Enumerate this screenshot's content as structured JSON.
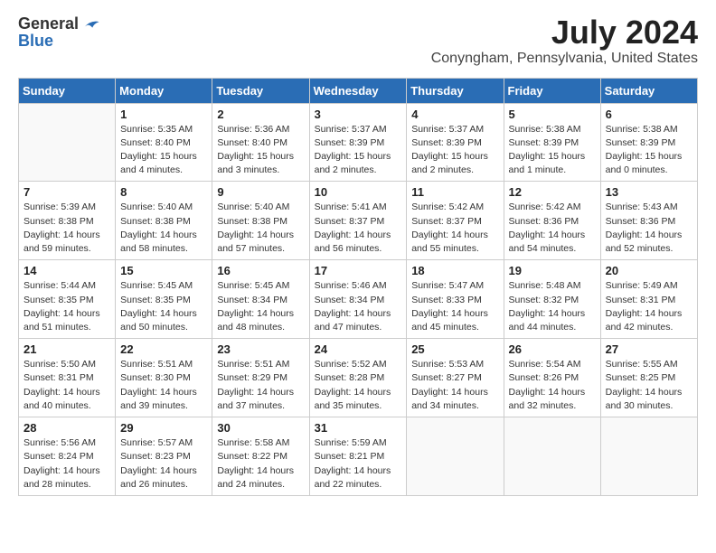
{
  "header": {
    "logo_general": "General",
    "logo_blue": "Blue",
    "month_year": "July 2024",
    "location": "Conyngham, Pennsylvania, United States"
  },
  "weekdays": [
    "Sunday",
    "Monday",
    "Tuesday",
    "Wednesday",
    "Thursday",
    "Friday",
    "Saturday"
  ],
  "weeks": [
    [
      {
        "day": "",
        "info": ""
      },
      {
        "day": "1",
        "info": "Sunrise: 5:35 AM\nSunset: 8:40 PM\nDaylight: 15 hours\nand 4 minutes."
      },
      {
        "day": "2",
        "info": "Sunrise: 5:36 AM\nSunset: 8:40 PM\nDaylight: 15 hours\nand 3 minutes."
      },
      {
        "day": "3",
        "info": "Sunrise: 5:37 AM\nSunset: 8:39 PM\nDaylight: 15 hours\nand 2 minutes."
      },
      {
        "day": "4",
        "info": "Sunrise: 5:37 AM\nSunset: 8:39 PM\nDaylight: 15 hours\nand 2 minutes."
      },
      {
        "day": "5",
        "info": "Sunrise: 5:38 AM\nSunset: 8:39 PM\nDaylight: 15 hours\nand 1 minute."
      },
      {
        "day": "6",
        "info": "Sunrise: 5:38 AM\nSunset: 8:39 PM\nDaylight: 15 hours\nand 0 minutes."
      }
    ],
    [
      {
        "day": "7",
        "info": "Sunrise: 5:39 AM\nSunset: 8:38 PM\nDaylight: 14 hours\nand 59 minutes."
      },
      {
        "day": "8",
        "info": "Sunrise: 5:40 AM\nSunset: 8:38 PM\nDaylight: 14 hours\nand 58 minutes."
      },
      {
        "day": "9",
        "info": "Sunrise: 5:40 AM\nSunset: 8:38 PM\nDaylight: 14 hours\nand 57 minutes."
      },
      {
        "day": "10",
        "info": "Sunrise: 5:41 AM\nSunset: 8:37 PM\nDaylight: 14 hours\nand 56 minutes."
      },
      {
        "day": "11",
        "info": "Sunrise: 5:42 AM\nSunset: 8:37 PM\nDaylight: 14 hours\nand 55 minutes."
      },
      {
        "day": "12",
        "info": "Sunrise: 5:42 AM\nSunset: 8:36 PM\nDaylight: 14 hours\nand 54 minutes."
      },
      {
        "day": "13",
        "info": "Sunrise: 5:43 AM\nSunset: 8:36 PM\nDaylight: 14 hours\nand 52 minutes."
      }
    ],
    [
      {
        "day": "14",
        "info": "Sunrise: 5:44 AM\nSunset: 8:35 PM\nDaylight: 14 hours\nand 51 minutes."
      },
      {
        "day": "15",
        "info": "Sunrise: 5:45 AM\nSunset: 8:35 PM\nDaylight: 14 hours\nand 50 minutes."
      },
      {
        "day": "16",
        "info": "Sunrise: 5:45 AM\nSunset: 8:34 PM\nDaylight: 14 hours\nand 48 minutes."
      },
      {
        "day": "17",
        "info": "Sunrise: 5:46 AM\nSunset: 8:34 PM\nDaylight: 14 hours\nand 47 minutes."
      },
      {
        "day": "18",
        "info": "Sunrise: 5:47 AM\nSunset: 8:33 PM\nDaylight: 14 hours\nand 45 minutes."
      },
      {
        "day": "19",
        "info": "Sunrise: 5:48 AM\nSunset: 8:32 PM\nDaylight: 14 hours\nand 44 minutes."
      },
      {
        "day": "20",
        "info": "Sunrise: 5:49 AM\nSunset: 8:31 PM\nDaylight: 14 hours\nand 42 minutes."
      }
    ],
    [
      {
        "day": "21",
        "info": "Sunrise: 5:50 AM\nSunset: 8:31 PM\nDaylight: 14 hours\nand 40 minutes."
      },
      {
        "day": "22",
        "info": "Sunrise: 5:51 AM\nSunset: 8:30 PM\nDaylight: 14 hours\nand 39 minutes."
      },
      {
        "day": "23",
        "info": "Sunrise: 5:51 AM\nSunset: 8:29 PM\nDaylight: 14 hours\nand 37 minutes."
      },
      {
        "day": "24",
        "info": "Sunrise: 5:52 AM\nSunset: 8:28 PM\nDaylight: 14 hours\nand 35 minutes."
      },
      {
        "day": "25",
        "info": "Sunrise: 5:53 AM\nSunset: 8:27 PM\nDaylight: 14 hours\nand 34 minutes."
      },
      {
        "day": "26",
        "info": "Sunrise: 5:54 AM\nSunset: 8:26 PM\nDaylight: 14 hours\nand 32 minutes."
      },
      {
        "day": "27",
        "info": "Sunrise: 5:55 AM\nSunset: 8:25 PM\nDaylight: 14 hours\nand 30 minutes."
      }
    ],
    [
      {
        "day": "28",
        "info": "Sunrise: 5:56 AM\nSunset: 8:24 PM\nDaylight: 14 hours\nand 28 minutes."
      },
      {
        "day": "29",
        "info": "Sunrise: 5:57 AM\nSunset: 8:23 PM\nDaylight: 14 hours\nand 26 minutes."
      },
      {
        "day": "30",
        "info": "Sunrise: 5:58 AM\nSunset: 8:22 PM\nDaylight: 14 hours\nand 24 minutes."
      },
      {
        "day": "31",
        "info": "Sunrise: 5:59 AM\nSunset: 8:21 PM\nDaylight: 14 hours\nand 22 minutes."
      },
      {
        "day": "",
        "info": ""
      },
      {
        "day": "",
        "info": ""
      },
      {
        "day": "",
        "info": ""
      }
    ]
  ]
}
